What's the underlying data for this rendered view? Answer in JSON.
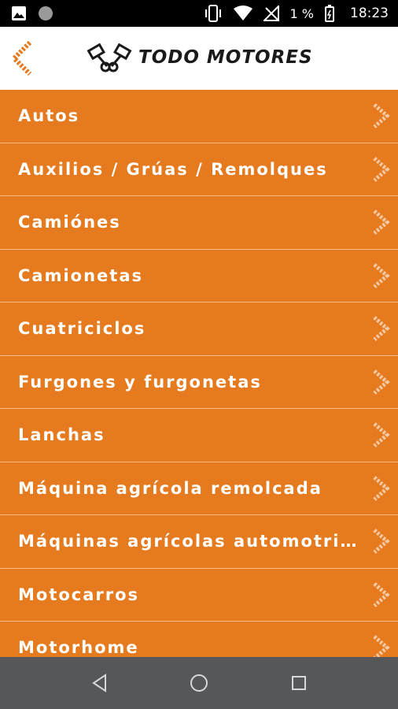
{
  "status_bar": {
    "battery_text": "1 %",
    "time": "18:23",
    "icons": [
      "image-icon",
      "circle-icon",
      "vibrate-icon",
      "wifi-icon",
      "no-signal-icon",
      "battery-icon"
    ]
  },
  "header": {
    "brand": "TODO MOTORES",
    "back_icon": "chevron-left-icon",
    "logo_icon": "pistons-icon",
    "accent_color": "#e67a1f"
  },
  "categories": [
    {
      "label": "Autos"
    },
    {
      "label": "Auxilios / Grúas / Remolques"
    },
    {
      "label": "Camiónes"
    },
    {
      "label": "Camionetas"
    },
    {
      "label": "Cuatriciclos"
    },
    {
      "label": "Furgones y furgonetas"
    },
    {
      "label": "Lanchas"
    },
    {
      "label": "Máquina agrícola remolcada"
    },
    {
      "label": "Máquinas agrícolas automotrices"
    },
    {
      "label": "Motocarros"
    },
    {
      "label": "Motorhome"
    }
  ],
  "nav_bar": {
    "icons": [
      "back-triangle-icon",
      "home-circle-icon",
      "recents-square-icon"
    ]
  }
}
